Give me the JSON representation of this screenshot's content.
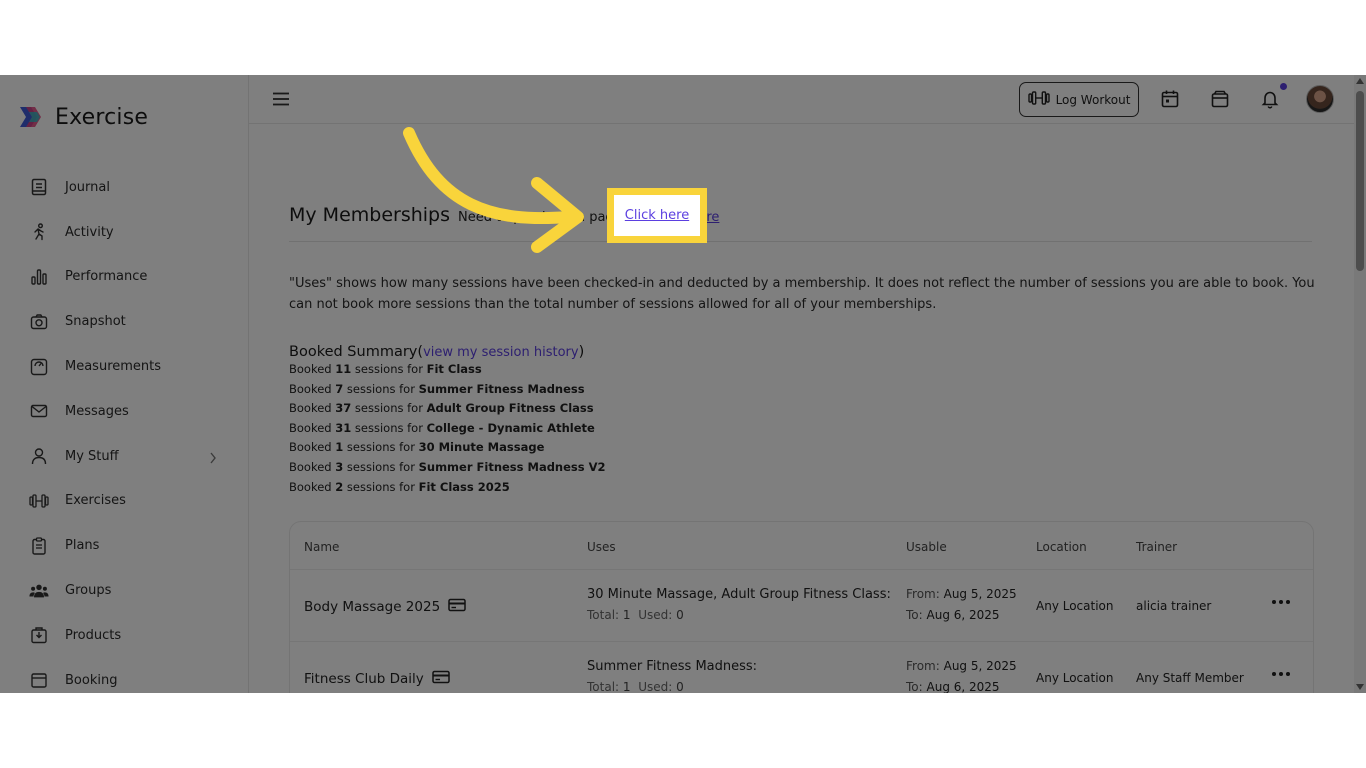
{
  "brand": {
    "name": "Exercise"
  },
  "sidebar": {
    "items": [
      {
        "label": "Journal",
        "icon": "journal-icon"
      },
      {
        "label": "Activity",
        "icon": "activity-icon"
      },
      {
        "label": "Performance",
        "icon": "performance-icon"
      },
      {
        "label": "Snapshot",
        "icon": "camera-icon"
      },
      {
        "label": "Measurements",
        "icon": "measurements-icon"
      },
      {
        "label": "Messages",
        "icon": "mail-icon"
      },
      {
        "label": "My Stuff",
        "icon": "user-icon",
        "has_submenu": true
      },
      {
        "label": "Exercises",
        "icon": "dumbbell-icon"
      },
      {
        "label": "Plans",
        "icon": "clipboard-icon"
      },
      {
        "label": "Groups",
        "icon": "groups-icon"
      },
      {
        "label": "Products",
        "icon": "products-icon"
      },
      {
        "label": "Booking",
        "icon": "booking-icon"
      }
    ]
  },
  "header": {
    "log_workout_label": "Log Workout",
    "icons": [
      "menu-icon",
      "dumbbell-icon",
      "calendar-icon",
      "store-icon",
      "bell-icon",
      "avatar"
    ],
    "notification_dot_color": "#5b3fe0"
  },
  "main": {
    "title": "My Memberships",
    "need_text": "Need to purchase a package?",
    "need_text_visible_start": "Need to p",
    "need_text_visible_end": "ackage",
    "question_mark": "?",
    "click_here": "Click here",
    "info": "\"Uses\" shows how many sessions have been checked-in and deducted by a membership. It does not reflect the number of sessions you are able to book. You can not book more sessions than the total number of sessions allowed for all of your memberships.",
    "summary": {
      "title": "Booked Summary",
      "open_paren": "(",
      "link": "view my session history",
      "close_paren": ")",
      "prefix": "Booked",
      "middle": "sessions for",
      "lines": [
        {
          "count": "11",
          "name": "Fit Class"
        },
        {
          "count": "7",
          "name": "Summer Fitness Madness"
        },
        {
          "count": "37",
          "name": "Adult Group Fitness Class"
        },
        {
          "count": "31",
          "name": "College - Dynamic Athlete"
        },
        {
          "count": "1",
          "name": "30 Minute Massage"
        },
        {
          "count": "3",
          "name": "Summer Fitness Madness V2"
        },
        {
          "count": "2",
          "name": "Fit Class 2025"
        }
      ]
    },
    "table": {
      "columns": [
        "Name",
        "Uses",
        "Usable",
        "Location",
        "Trainer"
      ],
      "rows": [
        {
          "name": "Body Massage 2025",
          "uses": "30 Minute Massage, Adult Group Fitness Class:",
          "total_label": "Total:",
          "total": "1",
          "used_label": "Used:",
          "used": "0",
          "from_label": "From:",
          "from": "Aug 5, 2025",
          "to_label": "To:",
          "to": "Aug 6, 2025",
          "location": "Any Location",
          "trainer": "alicia trainer"
        },
        {
          "name": "Fitness Club Daily",
          "uses": "Summer Fitness Madness:",
          "total_label": "Total:",
          "total": "1",
          "used_label": "Used:",
          "used": "0",
          "from_label": "From:",
          "from": "Aug 5, 2025",
          "to_label": "To:",
          "to": "Aug 6, 2025",
          "location": "Any Location",
          "trainer": "Any Staff Member"
        }
      ]
    }
  },
  "overlay": {
    "highlight_color": "#f9d43b",
    "dim_opacity": 0.5
  }
}
